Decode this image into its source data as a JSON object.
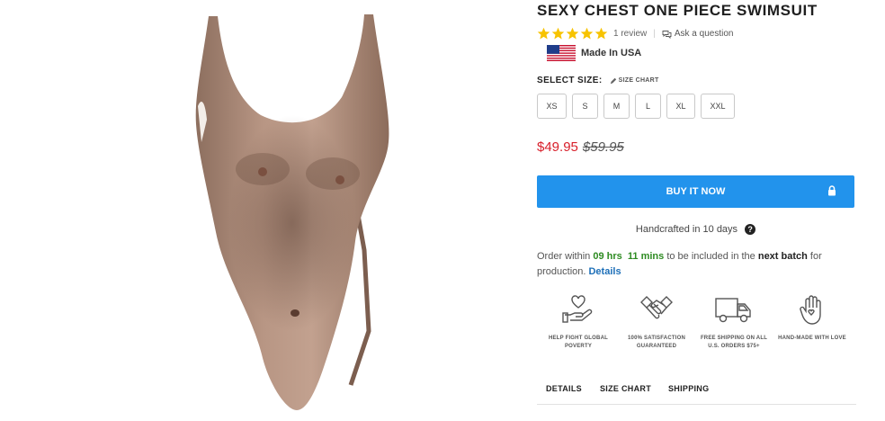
{
  "product": {
    "title": "SEXY CHEST ONE PIECE SWIMSUIT",
    "image_alt": "one-piece swimsuit with hairy chest print"
  },
  "rating": {
    "stars": 5,
    "review_count_label": "1 review",
    "ask_label": "Ask a question",
    "star_color": "#f7c300"
  },
  "origin": {
    "label": "Made In USA",
    "flag": "us-flag-icon"
  },
  "size_selector": {
    "label": "SELECT SIZE:",
    "chart_link": "SIZE CHART",
    "options": [
      "XS",
      "S",
      "M",
      "L",
      "XL",
      "XXL"
    ]
  },
  "pricing": {
    "price": "$49.95",
    "compare_at": "$59.95",
    "price_color": "#d8202b"
  },
  "buy": {
    "label": "BUY IT NOW",
    "color": "#2293ec",
    "icon": "lock-icon"
  },
  "handcrafted": {
    "label": "Handcrafted in 10 days",
    "help_glyph": "?"
  },
  "order": {
    "prefix": "Order within ",
    "hours": "09 hrs",
    "mins": "11 mins",
    "middle": " to be included in the ",
    "batch": "next batch",
    "suffix": " for production. ",
    "details_link": "Details"
  },
  "features": [
    {
      "icon": "heart-hand-icon",
      "label_line1": "HELP FIGHT GLOBAL",
      "label_line2": "POVERTY"
    },
    {
      "icon": "handshake-icon",
      "label_line1": "100% SATISFACTION",
      "label_line2": "GUARANTEED"
    },
    {
      "icon": "truck-icon",
      "label_line1": "FREE SHIPPING ON ALL",
      "label_line2": "U.S. ORDERS $75+"
    },
    {
      "icon": "raised-hand-icon",
      "label_line1": "HAND-MADE WITH LOVE",
      "label_line2": ""
    }
  ],
  "tabs": [
    "DETAILS",
    "SIZE CHART",
    "SHIPPING"
  ]
}
